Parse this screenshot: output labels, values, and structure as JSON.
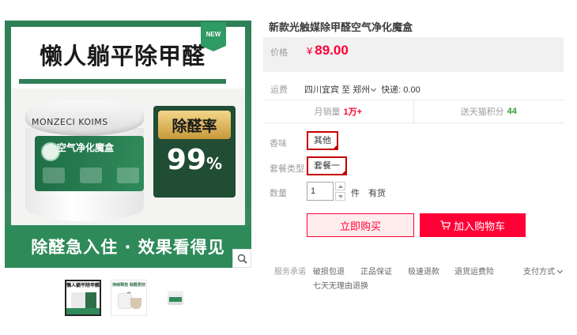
{
  "gallery": {
    "badge": "NEW",
    "headline": "懒人躺平除甲醛",
    "brand": "MONZECI KOIMS",
    "product_label": "空气净化魔盒",
    "rate_label": "除醛率",
    "rate_value": "99",
    "rate_unit": "%",
    "slogan": "除醛急入住 · 效果看得见",
    "thumb1_text": "懒人躺平除甲醛",
    "thumb2_text": "持续释放 除醛更彻底",
    "colors": {
      "green": "#2f8a5a",
      "dark_green": "#204d33",
      "gold": "#c89a3a"
    }
  },
  "product": {
    "title": "新款光触媒除甲醛空气净化魔盒",
    "price_label": "价格",
    "currency": "¥",
    "price": "89.00",
    "accent": "#ff0036"
  },
  "shipping": {
    "label": "运费",
    "from": "四川宜宾",
    "to_word": "至",
    "to": "郑州",
    "express": "快递: 0.00"
  },
  "stats": {
    "monthly_sales_label": "月销量",
    "monthly_sales_value": "1万+",
    "points_label": "送天猫积分",
    "points_value": "44"
  },
  "options": {
    "scent_label": "香味",
    "scent_value": "其他",
    "package_label": "套餐类型",
    "package_value": "套餐一",
    "quantity_label": "数量",
    "quantity_value": "1",
    "unit": "件",
    "stock": "有货"
  },
  "actions": {
    "buy_now": "立即购买",
    "add_to_cart": "加入购物车"
  },
  "services": {
    "label": "服务承诺",
    "items": [
      "破损包退",
      "正品保证",
      "极速退款",
      "退货运费险",
      "七天无理由退换"
    ],
    "payment": "支付方式"
  }
}
